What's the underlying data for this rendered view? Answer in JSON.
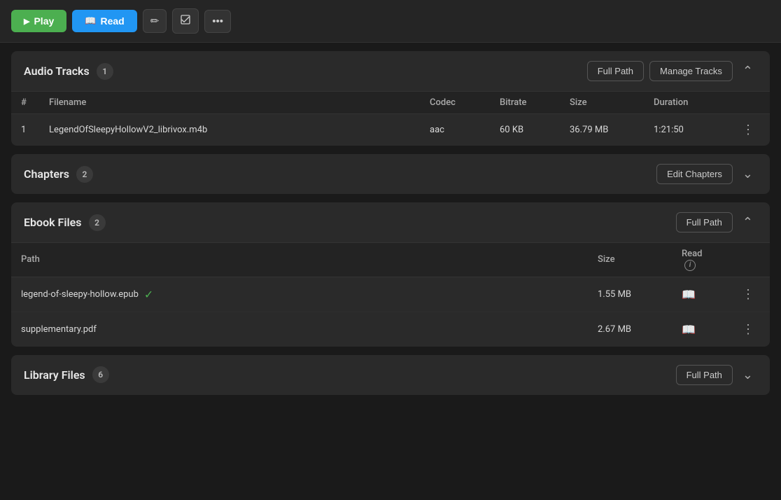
{
  "toolbar": {
    "play_label": "Play",
    "read_label": "Read",
    "edit_icon": "✏",
    "bookmark_icon": "⊘",
    "more_icon": "•••"
  },
  "audio_tracks": {
    "title": "Audio Tracks",
    "count": "1",
    "full_path_btn": "Full Path",
    "manage_tracks_btn": "Manage Tracks",
    "collapsed": false,
    "columns": {
      "num": "#",
      "filename": "Filename",
      "codec": "Codec",
      "bitrate": "Bitrate",
      "size": "Size",
      "duration": "Duration"
    },
    "rows": [
      {
        "num": "1",
        "filename": "LegendOfSleepyHollowV2_librivox.m4b",
        "codec": "aac",
        "bitrate": "60 KB",
        "size": "36.79 MB",
        "duration": "1:21:50"
      }
    ]
  },
  "chapters": {
    "title": "Chapters",
    "count": "2",
    "edit_chapters_btn": "Edit Chapters",
    "collapsed": true
  },
  "ebook_files": {
    "title": "Ebook Files",
    "count": "2",
    "full_path_btn": "Full Path",
    "collapsed": false,
    "columns": {
      "path": "Path",
      "size": "Size",
      "read": "Read"
    },
    "rows": [
      {
        "filename": "legend-of-sleepy-hollow.epub",
        "has_check": true,
        "size": "1.55 MB"
      },
      {
        "filename": "supplementary.pdf",
        "has_check": false,
        "size": "2.67 MB"
      }
    ]
  },
  "library_files": {
    "title": "Library Files",
    "count": "6",
    "full_path_btn": "Full Path",
    "collapsed": true
  }
}
